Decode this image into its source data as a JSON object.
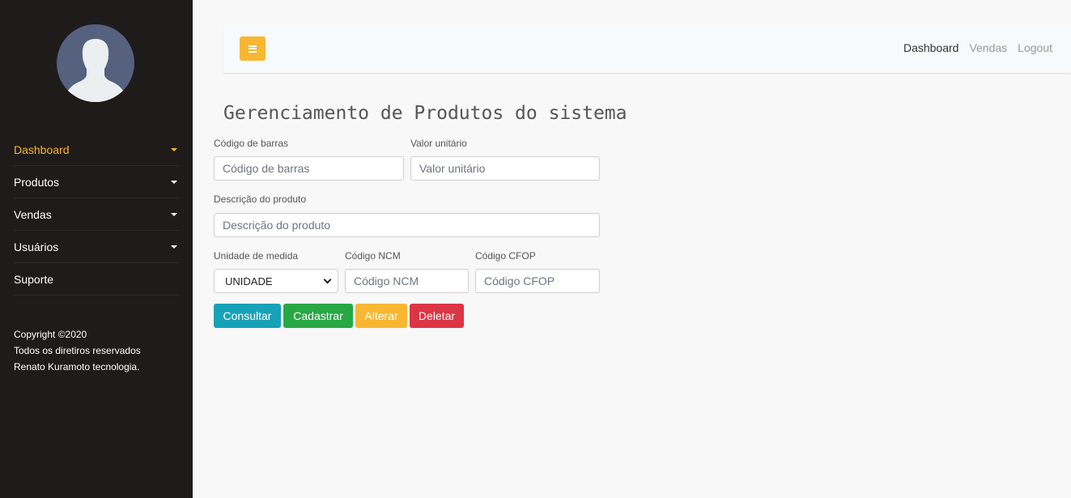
{
  "sidebar": {
    "items": [
      {
        "label": "Dashboard"
      },
      {
        "label": "Produtos"
      },
      {
        "label": "Vendas"
      },
      {
        "label": "Usuários"
      },
      {
        "label": "Suporte"
      }
    ],
    "copyright": [
      "Copyright ©2020",
      "Todos os diretiros reservados",
      "Renato Kuramoto tecnologia."
    ]
  },
  "topbar": {
    "links": [
      {
        "label": "Dashboard"
      },
      {
        "label": "Vendas"
      },
      {
        "label": "Logout"
      }
    ]
  },
  "page": {
    "title": "Gerenciamento de Produtos do sistema"
  },
  "form": {
    "barcode": {
      "label": "Código de barras",
      "placeholder": "Código de barras"
    },
    "unit_price": {
      "label": "Valor unitário",
      "placeholder": "Valor unitário"
    },
    "description": {
      "label": "Descrição do produto",
      "placeholder": "Descrição do produto"
    },
    "unit": {
      "label": "Unidade de medida",
      "value": "UNIDADE"
    },
    "ncm": {
      "label": "Código NCM",
      "placeholder": "Código NCM"
    },
    "cfop": {
      "label": "Código CFOP",
      "placeholder": "Código CFOP"
    }
  },
  "buttons": {
    "consultar": "Consultar",
    "cadastrar": "Cadastrar",
    "alterar": "Alterar",
    "deletar": "Deletar"
  },
  "colors": {
    "sidebar_bg": "#1f1b1a",
    "accent": "#f7b733",
    "info": "#17a2b8",
    "success": "#28a745",
    "warning": "#f7b733",
    "danger": "#dc3545"
  }
}
